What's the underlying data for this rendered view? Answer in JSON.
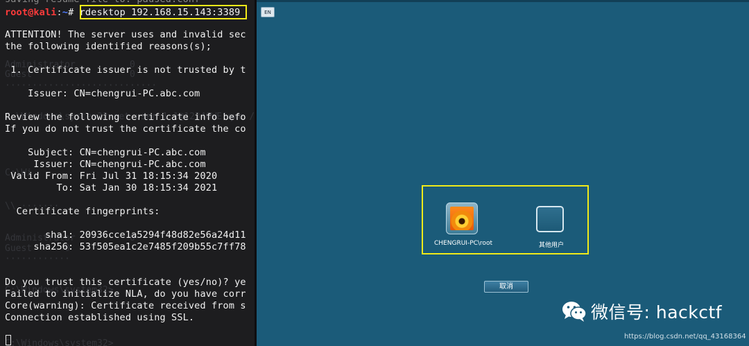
{
  "terminal": {
    "top_cut_line": "saving resume file to: paused.conf",
    "prompt": {
      "user_host": "root@kali",
      "separator": ":",
      "path": "~",
      "symbol": "# "
    },
    "command": "rdesktop 192.168.15.143:3389",
    "output": [
      "ATTENTION! The server uses and invalid sec",
      "the following identified reasons(s);",
      "",
      " 1. Certificate issuer is not trusted by t",
      "",
      "    Issuer: CN=chengrui-PC.abc.com",
      "",
      "Review the following certificate info befo",
      "If you do not trust the certificate the co",
      "",
      "    Subject: CN=chengrui-PC.abc.com",
      "     Issuer: CN=chengrui-PC.abc.com",
      " Valid From: Fri Jul 31 18:15:34 2020",
      "         To: Sat Jan 30 18:15:34 2021",
      "",
      "  Certificate fingerprints:",
      "",
      "       sha1: 20936cce1a5294f48d82e56a24d11",
      "     sha256: 53f505ea1c2e7485f209b55c7ff78",
      "",
      "",
      "Do you trust this certificate (yes/no)? ye",
      "Failed to initialize NLA, do you have corr",
      "Core(warning): Certificate received from s",
      "Connection established using SSL."
    ],
    "ghost_lines": [
      "Administrator          0",
      "Guest                  0",
      "····························",
      "C:\\Windows\\system32>net user 1 1@1234QWE!qwe /add",
      "C:\\Wi",
      "\\\\ ·······",
      "Administrator          0",
      "Guest      0",
      "············",
      "C:\\Windows\\system32>",
      "C:\\Windows\\system32>"
    ]
  },
  "rdp": {
    "lang_indicator": "EN",
    "users": [
      {
        "name": "CHENGRUI-PC\\root"
      },
      {
        "name": "其他用户"
      }
    ],
    "cancel_label": "取消"
  },
  "overlay": {
    "wechat_title": "微信号: hackctf",
    "watermark": "https://blog.csdn.net/qq_43168364"
  },
  "colors": {
    "terminal_bg": "#1d1d1f",
    "rdp_bg": "#1b5b79",
    "highlight": "#f4ec19",
    "prompt_user": "#ff3b3b",
    "prompt_path": "#4f7cff"
  }
}
